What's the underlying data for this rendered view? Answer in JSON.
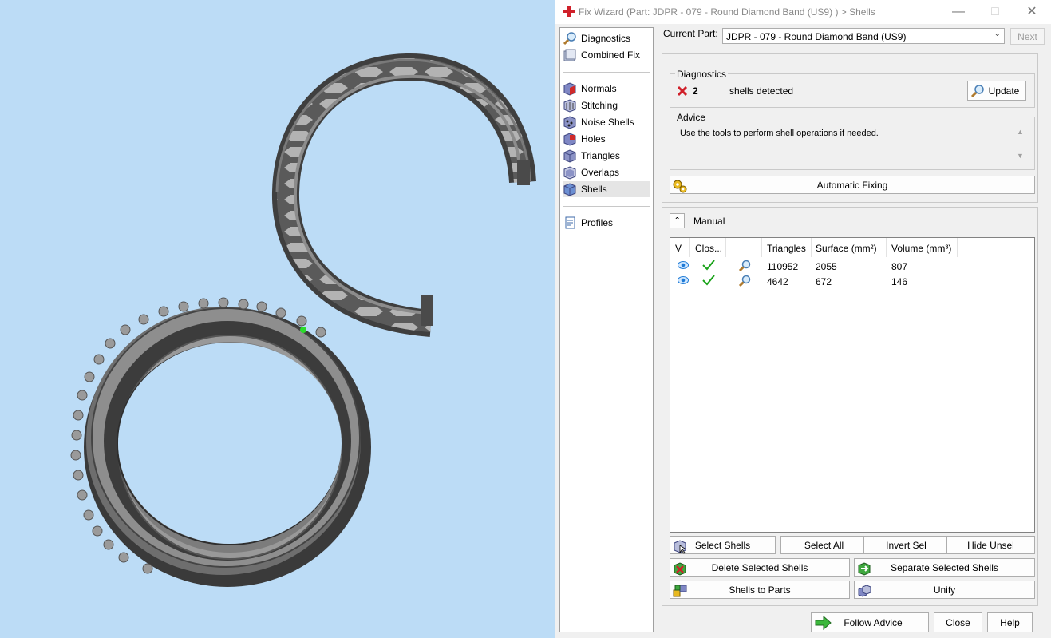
{
  "window": {
    "title": "Fix Wizard (Part: JDPR - 079 - Round Diamond Band (US9) ) > Shells",
    "minimize_icon": "minimize-icon",
    "maximize_icon": "maximize-icon",
    "close_icon": "close-icon"
  },
  "nav": {
    "top": [
      {
        "label": "Diagnostics",
        "icon": "diagnostics-icon"
      },
      {
        "label": "Combined Fix",
        "icon": "combined-fix-icon"
      }
    ],
    "fixes": [
      {
        "label": "Normals",
        "icon": "normals-icon"
      },
      {
        "label": "Stitching",
        "icon": "stitching-icon"
      },
      {
        "label": "Noise Shells",
        "icon": "noise-shells-icon"
      },
      {
        "label": "Holes",
        "icon": "holes-icon"
      },
      {
        "label": "Triangles",
        "icon": "triangles-icon"
      },
      {
        "label": "Overlaps",
        "icon": "overlaps-icon"
      },
      {
        "label": "Shells",
        "icon": "shells-icon",
        "selected": true
      }
    ],
    "bottom": [
      {
        "label": "Profiles",
        "icon": "profiles-icon"
      }
    ]
  },
  "current_part": {
    "label": "Current Part:",
    "value": "JDPR - 079 - Round Diamond Band (US9)",
    "next_label": "Next"
  },
  "diagnostics": {
    "title": "Diagnostics",
    "count": "2",
    "status_text": "shells detected",
    "update_label": "Update"
  },
  "advice": {
    "title": "Advice",
    "text": "Use the tools to perform shell operations if needed."
  },
  "automatic_fixing_label": "Automatic Fixing",
  "manual": {
    "label": "Manual",
    "columns": [
      "V",
      "Clos...",
      "",
      "Triangles",
      "Surface (mm²)",
      "Volume (mm³)"
    ],
    "rows": [
      {
        "triangles": "110952",
        "surface": "2055",
        "volume": "807"
      },
      {
        "triangles": "4642",
        "surface": "672",
        "volume": "146"
      }
    ]
  },
  "buttons": {
    "select_shells": "Select Shells",
    "select_all": "Select All",
    "invert_sel": "Invert Sel",
    "hide_unsel": "Hide Unsel",
    "delete_selected_shells": "Delete Selected Shells",
    "separate_selected_shells": "Separate Selected Shells",
    "shells_to_parts": "Shells to Parts",
    "unify": "Unify",
    "follow_advice": "Follow Advice",
    "close": "Close",
    "help": "Help"
  },
  "colors": {
    "viewport_bg": "#bcdcf6",
    "ring_gray": "#8c8c8c",
    "check_green": "#1aa31a",
    "error_red": "#d0202a"
  }
}
